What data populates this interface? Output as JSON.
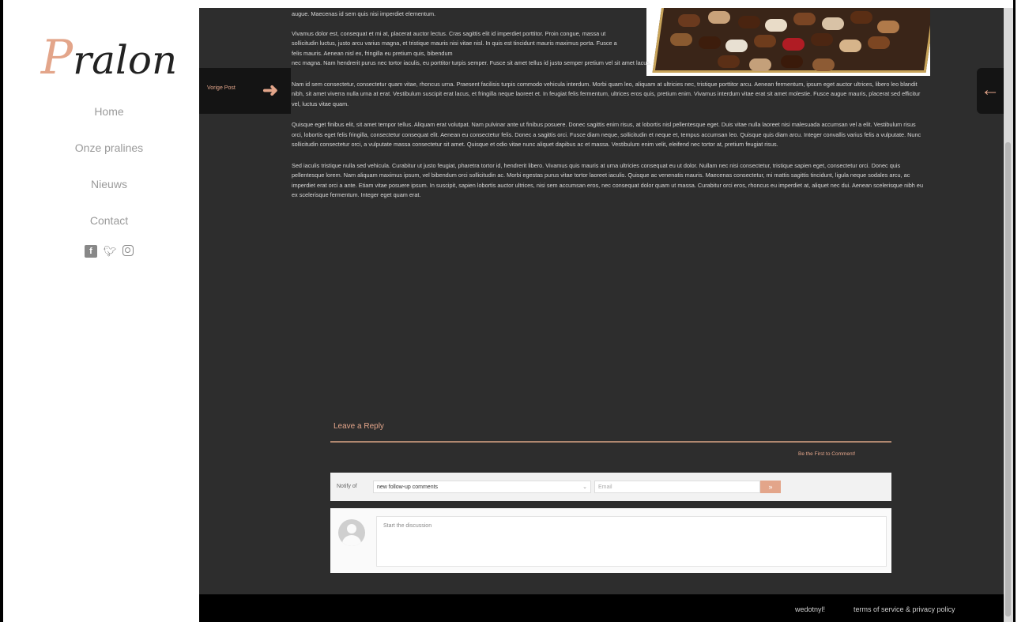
{
  "sidebar": {
    "logo_first": "P",
    "logo_rest": "ralon",
    "nav": [
      "Home",
      "Onze pralines",
      "Nieuws",
      "Contact"
    ],
    "social": [
      "facebook-icon",
      "twitter-icon",
      "instagram-icon"
    ]
  },
  "post_nav": {
    "prev_label": "Vorige Post",
    "prev_arrow": "➜",
    "next_arrow": "←"
  },
  "article": {
    "p1": "augue. Maecenas id sem quis nisi imperdiet elementum.",
    "p2a": "Vivamus dolor est, consequat et mi at, placerat auctor lectus. Cras sagittis elit id imperdiet porttitor. Proin congue, massa ut sollicitudin luctus, justo arcu varius magna, et tristique mauris nisi vitae nisl. In quis est tincidunt mauris maximus porta. Fusce a felis mauris. Aenean nisl ex, fringilla eu pretium quis, bibendum",
    "p2b": "nec magna. Nam hendrerit purus nec tortor iaculis, eu porttitor turpis semper. Fusce sit amet tellus id justo semper pretium vel sit amet lacus.",
    "p3": "Nam id sem consectetur, consectetur quam vitae, rhoncus urna. Praesent facilisis turpis commodo vehicula interdum. Morbi quam leo, aliquam at ultricies nec, tristique porttitor arcu. Aenean fermentum, ipsum eget auctor ultrices, libero leo blandit nibh, sit amet viverra nulla urna at erat. Vestibulum suscipit erat lacus, et fringilla neque laoreet et. In feugiat felis fermentum, ultrices eros quis, pretium enim. Vivamus interdum vitae erat sit amet molestie. Fusce augue mauris, placerat sed efficitur vel, luctus vitae quam.",
    "p4": "Quisque eget finibus elit, sit amet tempor tellus. Aliquam erat volutpat. Nam pulvinar ante ut finibus posuere. Donec sagittis enim risus, at lobortis nisl pellentesque eget. Duis vitae nulla laoreet nisi malesuada accumsan vel a elit. Vestibulum risus orci, lobortis eget felis fringilla, consectetur consequat elit. Aenean eu consectetur felis. Donec a sagittis orci. Fusce diam neque, sollicitudin et neque et, tempus accumsan leo. Quisque quis diam arcu. Integer convallis varius felis a vulputate. Nunc sollicitudin consectetur orci, a vulputate massa consectetur sit amet. Quisque et odio vitae nunc aliquet dapibus ac et massa. Vestibulum enim velit, eleifend nec tortor at, pretium feugiat risus.",
    "p5": "Sed iaculis tristique nulla sed vehicula. Curabitur ut justo feugiat, pharetra tortor id, hendrerit libero. Vivamus quis mauris at urna ultricies consequat eu ut dolor. Nullam nec nisi consectetur, tristique sapien eget, consectetur orci. Donec quis pellentesque lorem. Nam aliquam maximus ipsum, vel bibendum orci sollicitudin ac. Morbi egestas purus vitae tortor laoreet iaculis. Quisque ac venenatis mauris. Maecenas consectetur, mi mattis sagittis tincidunt, ligula neque sodales arcu, ac imperdiet erat orci a ante. Etiam vitae posuere ipsum. In suscipit, sapien lobortis auctor ultrices, nisi sem accumsan eros, nec consequat dolor quam ut massa. Curabitur orci eros, rhoncus eu imperdiet at, aliquet nec dui. Aenean scelerisque nibh eu ex scelerisque fermentum. Integer eget quam erat."
  },
  "comments": {
    "title": "Leave a Reply",
    "first_comment": "Be the First to Comment!",
    "notify_label": "Notify of",
    "notify_selected": "new follow-up comments",
    "email_placeholder": "Email",
    "subscribe_symbol": "»",
    "comment_placeholder": "Start the discussion"
  },
  "footer": {
    "credit": "wedotnyl!",
    "terms": "terms of service & privacy policy"
  },
  "colors": {
    "accent": "#e3a58a",
    "main_bg": "#2d2d2d",
    "footer_bg": "#000000"
  }
}
